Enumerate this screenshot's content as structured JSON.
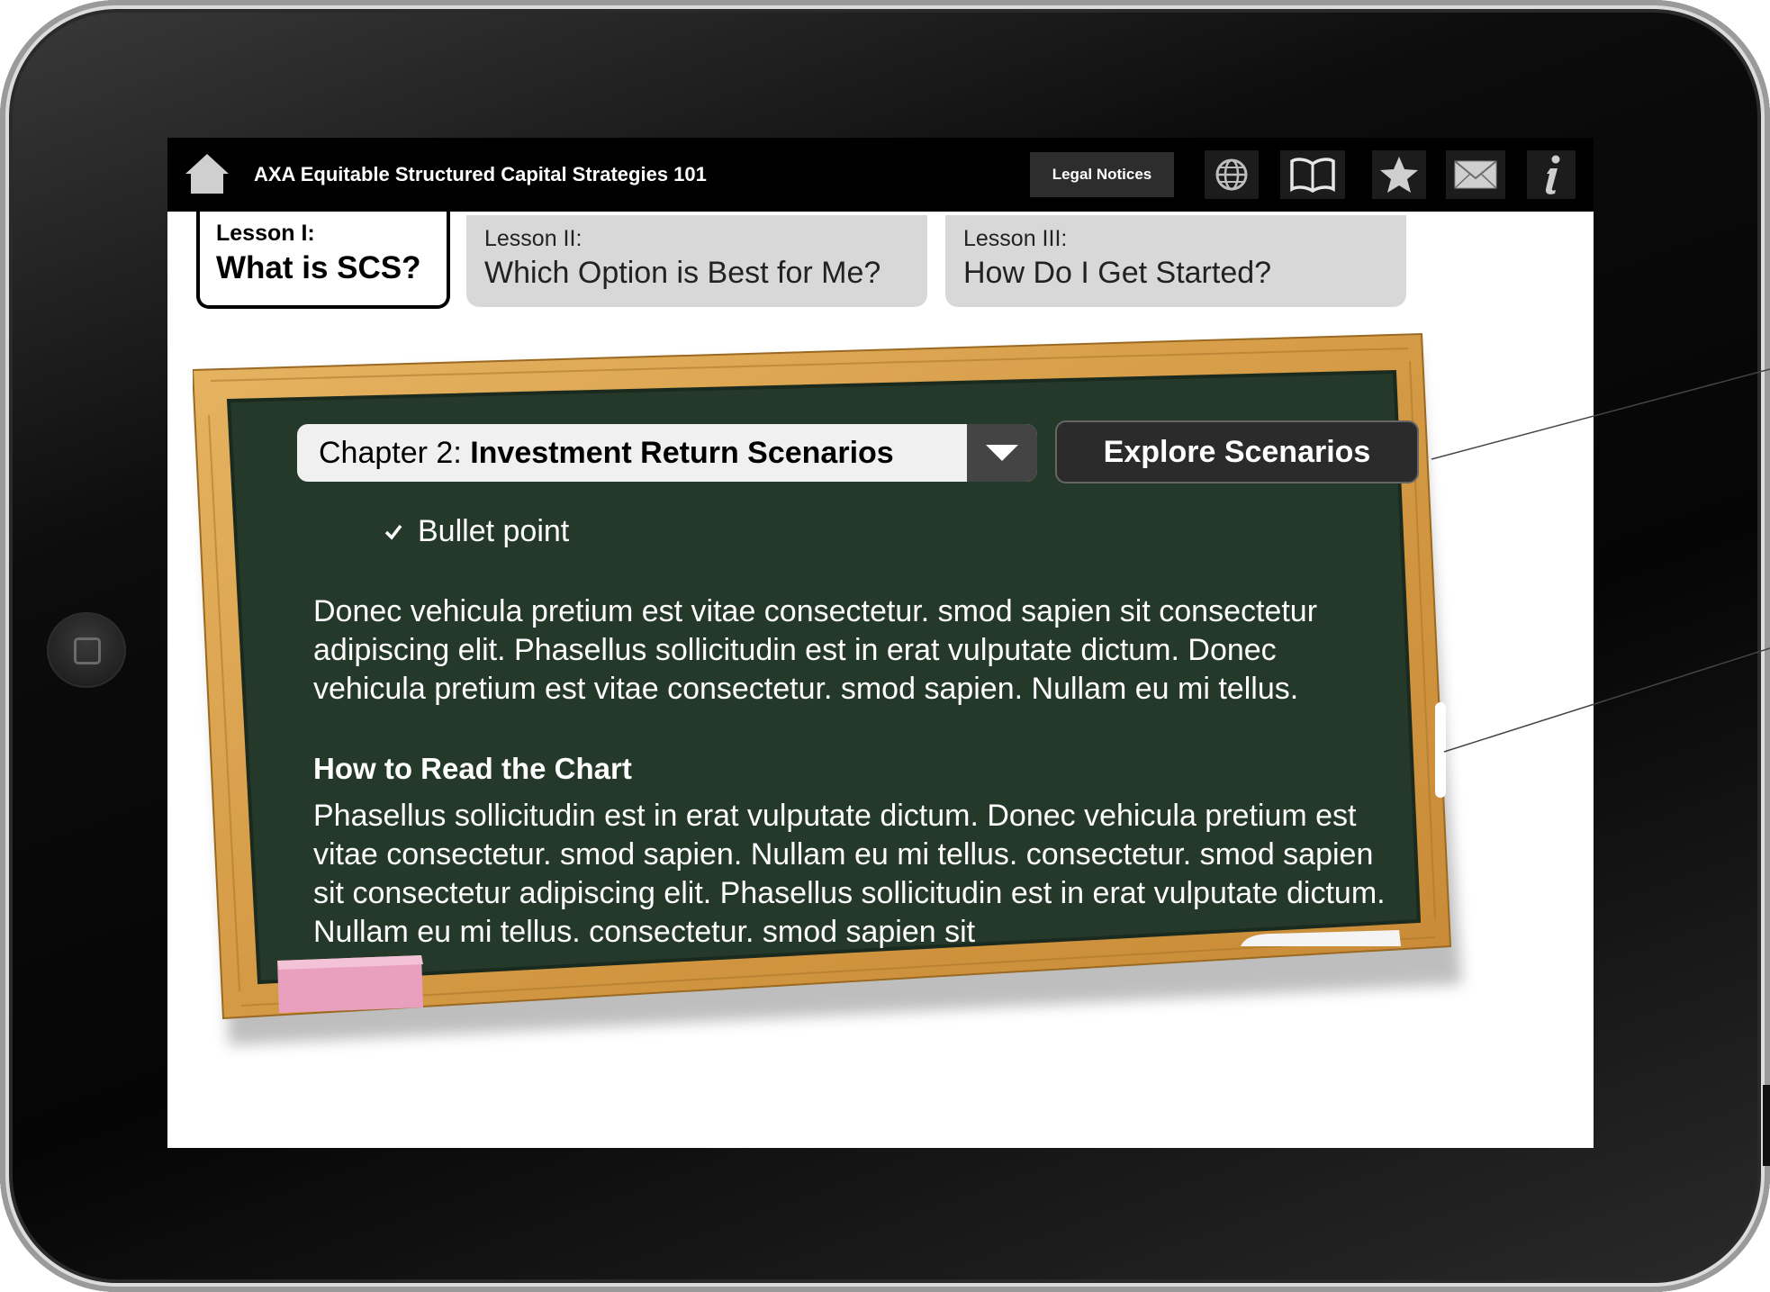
{
  "app": {
    "title": "AXA Equitable Structured Capital Strategies 101"
  },
  "toolbar": {
    "legal_label": "Legal Notices",
    "icons": [
      "home-icon",
      "globe-icon",
      "book-icon",
      "star-icon",
      "mail-icon",
      "info-icon"
    ]
  },
  "tabs": [
    {
      "sub": "Lesson I:",
      "main": "What is SCS?",
      "active": true
    },
    {
      "sub": "Lesson II:",
      "main": "Which Option is Best for Me?",
      "active": false
    },
    {
      "sub": "Lesson III:",
      "main": "How Do I Get Started?",
      "active": false
    }
  ],
  "chapter": {
    "prefix": "Chapter 2: ",
    "title": "Investment Return Scenarios"
  },
  "explore_label": "Explore Scenarios",
  "content": {
    "bullet": "Bullet point",
    "paragraph1": "Donec vehicula pretium est vitae consectetur. smod sapien sit consectetur adipiscing elit. Phasellus sollicitudin est in erat vulputate dictum. Donec vehicula pretium est vitae consectetur. smod sapien. Nullam eu mi tellus.",
    "heading": "How to Read the Chart",
    "paragraph2": "Phasellus sollicitudin est in erat vulputate dictum. Donec vehicula pretium est vitae consectetur. smod sapien. Nullam eu mi tellus. consectetur. smod sapien sit consectetur adipiscing elit. Phasellus sollicitudin est in erat vulputate dictum. Nullam eu mi tellus. consectetur. smod sapien sit"
  },
  "colors": {
    "board": "#25392a",
    "frame": "#d9a24f",
    "topbar": "#000000",
    "tab_inactive": "#d8d8d8"
  }
}
